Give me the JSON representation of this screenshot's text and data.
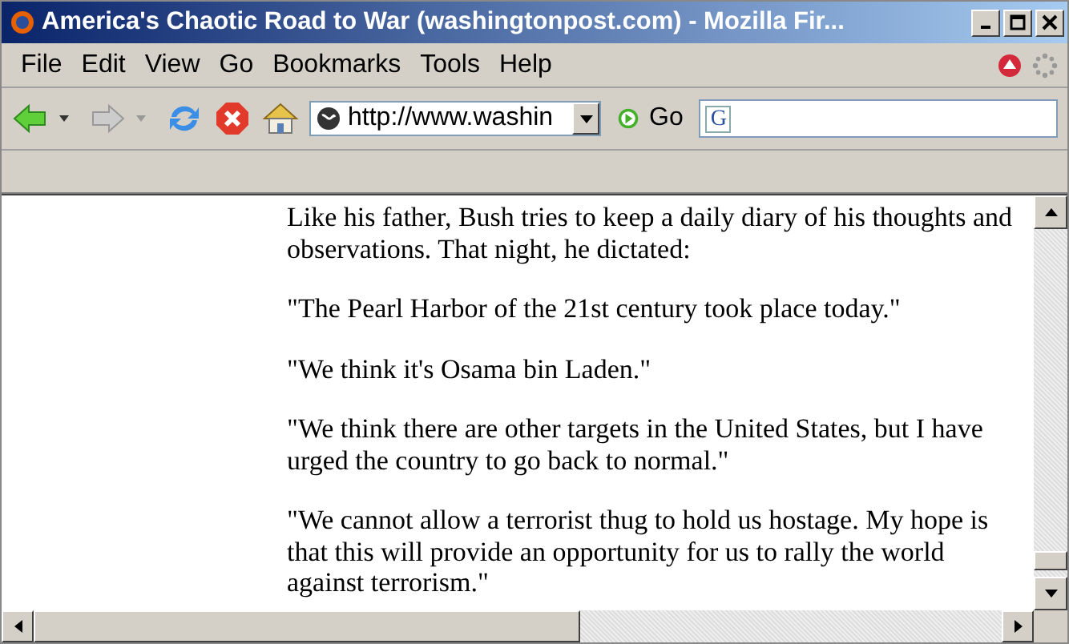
{
  "window": {
    "title": "America's Chaotic Road to War (washingtonpost.com) - Mozilla Fir..."
  },
  "menu": [
    "File",
    "Edit",
    "View",
    "Go",
    "Bookmarks",
    "Tools",
    "Help"
  ],
  "address": {
    "value": "http://www.washin"
  },
  "go_button": {
    "label": "Go"
  },
  "search": {
    "logo": "G"
  },
  "paragraphs": [
    "Like his father, Bush tries to keep a daily diary of his thoughts and observations. That night, he dictated:",
    "\"The Pearl Harbor of the 21st century took place today.\"",
    "\"We think it's Osama bin Laden.\"",
    "\"We think there are other targets in the United States, but I have urged the country to go back to normal.\"",
    "\"We cannot allow a terrorist thug to hold us hostage. My hope is that this will provide an opportunity for us to rally the world against terrorism.\""
  ]
}
